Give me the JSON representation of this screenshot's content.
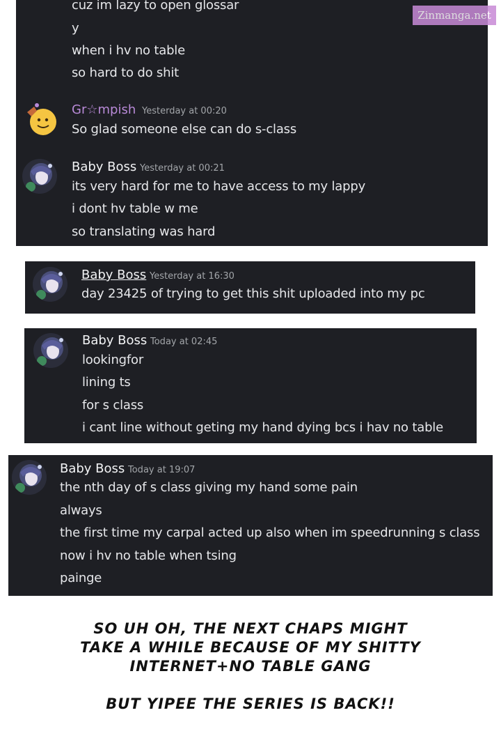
{
  "watermark": "Zinmanga.net",
  "panel1": {
    "top_lines": [
      "cuz im lazy to open glossar",
      "y",
      "when i hv no table",
      "so hard to do shit"
    ],
    "msg_grumpish": {
      "user": "Gr☆mpish",
      "time": "Yesterday at 00:20",
      "lines": [
        "So glad someone else can do s-class"
      ],
      "user_color": "#b98ad8"
    },
    "msg_babyboss": {
      "user": "Baby Boss",
      "time": "Yesterday at 00:21",
      "lines": [
        "its very hard for me to have access to my lappy",
        "i dont hv table w me",
        "so translating was hard"
      ]
    }
  },
  "panel2": {
    "user": "Baby Boss",
    "time": "Yesterday at 16:30",
    "lines": [
      "day 23425 of trying to get this shit uploaded into my pc"
    ]
  },
  "panel3": {
    "user": "Baby Boss",
    "time": "Today at 02:45",
    "lines": [
      "lookingfor",
      "lining ts",
      "for s class",
      "i cant line without geting my hand dying bcs i hav no table"
    ]
  },
  "panel4": {
    "user": "Baby Boss",
    "time": "Today at 19:07",
    "lines": [
      "the nth day of s class giving my hand some pain",
      "always",
      "the first time my carpal acted up also when im speedrunning s class",
      "now i hv no table when tsing",
      "painge"
    ]
  },
  "note": {
    "lines": [
      "SO UH OH, THE NEXT CHAPS MIGHT",
      "TAKE A WHILE BECAUSE OF MY SHITTY",
      "INTERNET+NO TABLE GANG",
      "BUT YIPEE THE SERIES IS BACK!!"
    ]
  }
}
